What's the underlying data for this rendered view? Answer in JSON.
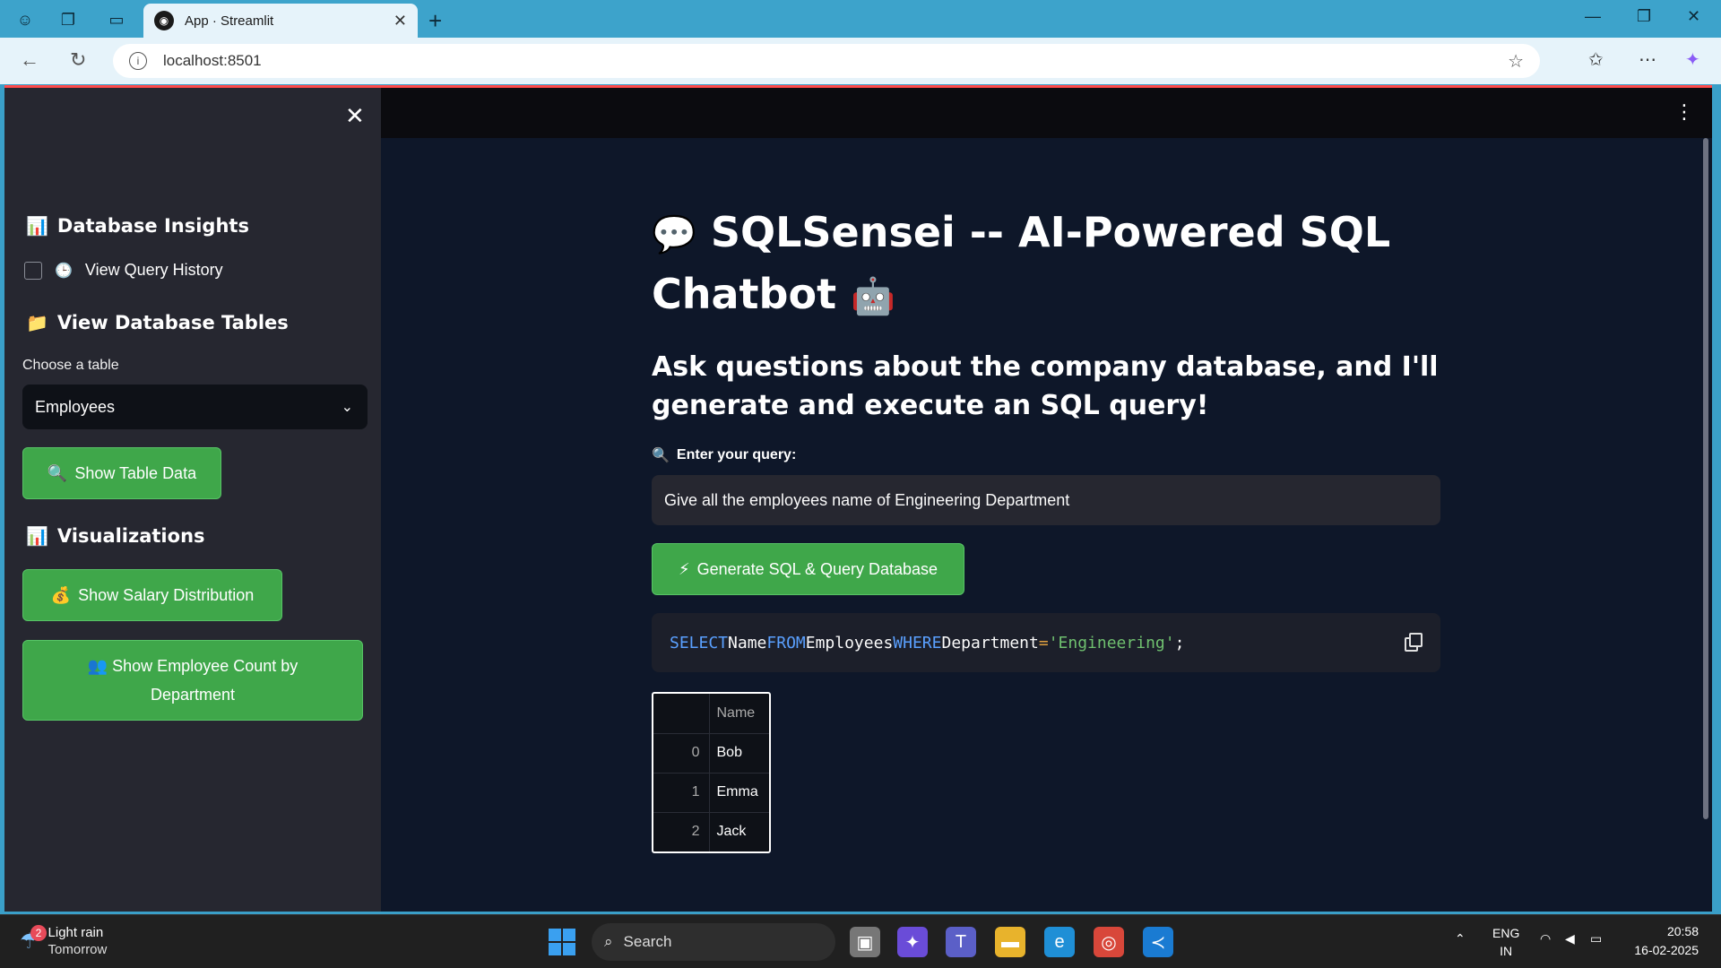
{
  "browser": {
    "tab_title": "App · Streamlit",
    "url": "localhost:8501"
  },
  "sidebar": {
    "insights_heading": "Database Insights",
    "query_history_label": "View Query History",
    "tables_heading": "View Database Tables",
    "choose_table_label": "Choose a table",
    "selected_table": "Employees",
    "show_table_button": "Show Table Data",
    "visualizations_heading": "Visualizations",
    "salary_button": "Show Salary Distribution",
    "employee_count_button": "Show Employee Count by Department"
  },
  "main": {
    "title": "SQLSensei -- AI-Powered SQL Chatbot",
    "subtitle": "Ask questions about the company database, and I'll generate and execute an SQL query!",
    "query_label": "Enter your query:",
    "query_value": "Give all the employees name of Engineering Department",
    "generate_button": "Generate SQL & Query Database",
    "sql": {
      "kw_select": "SELECT",
      "col": "Name",
      "kw_from": "FROM",
      "table": "Employees",
      "kw_where": "WHERE",
      "field": "Department",
      "op": "=",
      "value": "'Engineering'",
      "end": ";"
    },
    "result_table": {
      "header": "Name",
      "rows": [
        {
          "index": "0",
          "name": "Bob"
        },
        {
          "index": "1",
          "name": "Emma"
        },
        {
          "index": "2",
          "name": "Jack"
        }
      ]
    }
  },
  "taskbar": {
    "weather_badge": "2",
    "weather_line1": "Light rain",
    "weather_line2": "Tomorrow",
    "search_placeholder": "Search",
    "lang_line1": "ENG",
    "lang_line2": "IN",
    "time": "20:58",
    "date": "16-02-2025"
  },
  "colors": {
    "accent_green": "#3fa74a",
    "app_bg": "#0e1729",
    "sidebar_bg": "#262730",
    "browser_chrome": "#3da3cb"
  },
  "icons": {
    "insights": "bar-chart-icon",
    "history": "clock-icon",
    "tables": "folder-icon",
    "visualizations": "bar-chart-icon",
    "show_table": "magnifier-icon",
    "salary": "money-bag-icon",
    "employee_count": "people-icon",
    "title": "speech-bubble-icon",
    "title_end": "robot-icon",
    "query": "magnifier-icon",
    "generate": "lightning-icon"
  }
}
